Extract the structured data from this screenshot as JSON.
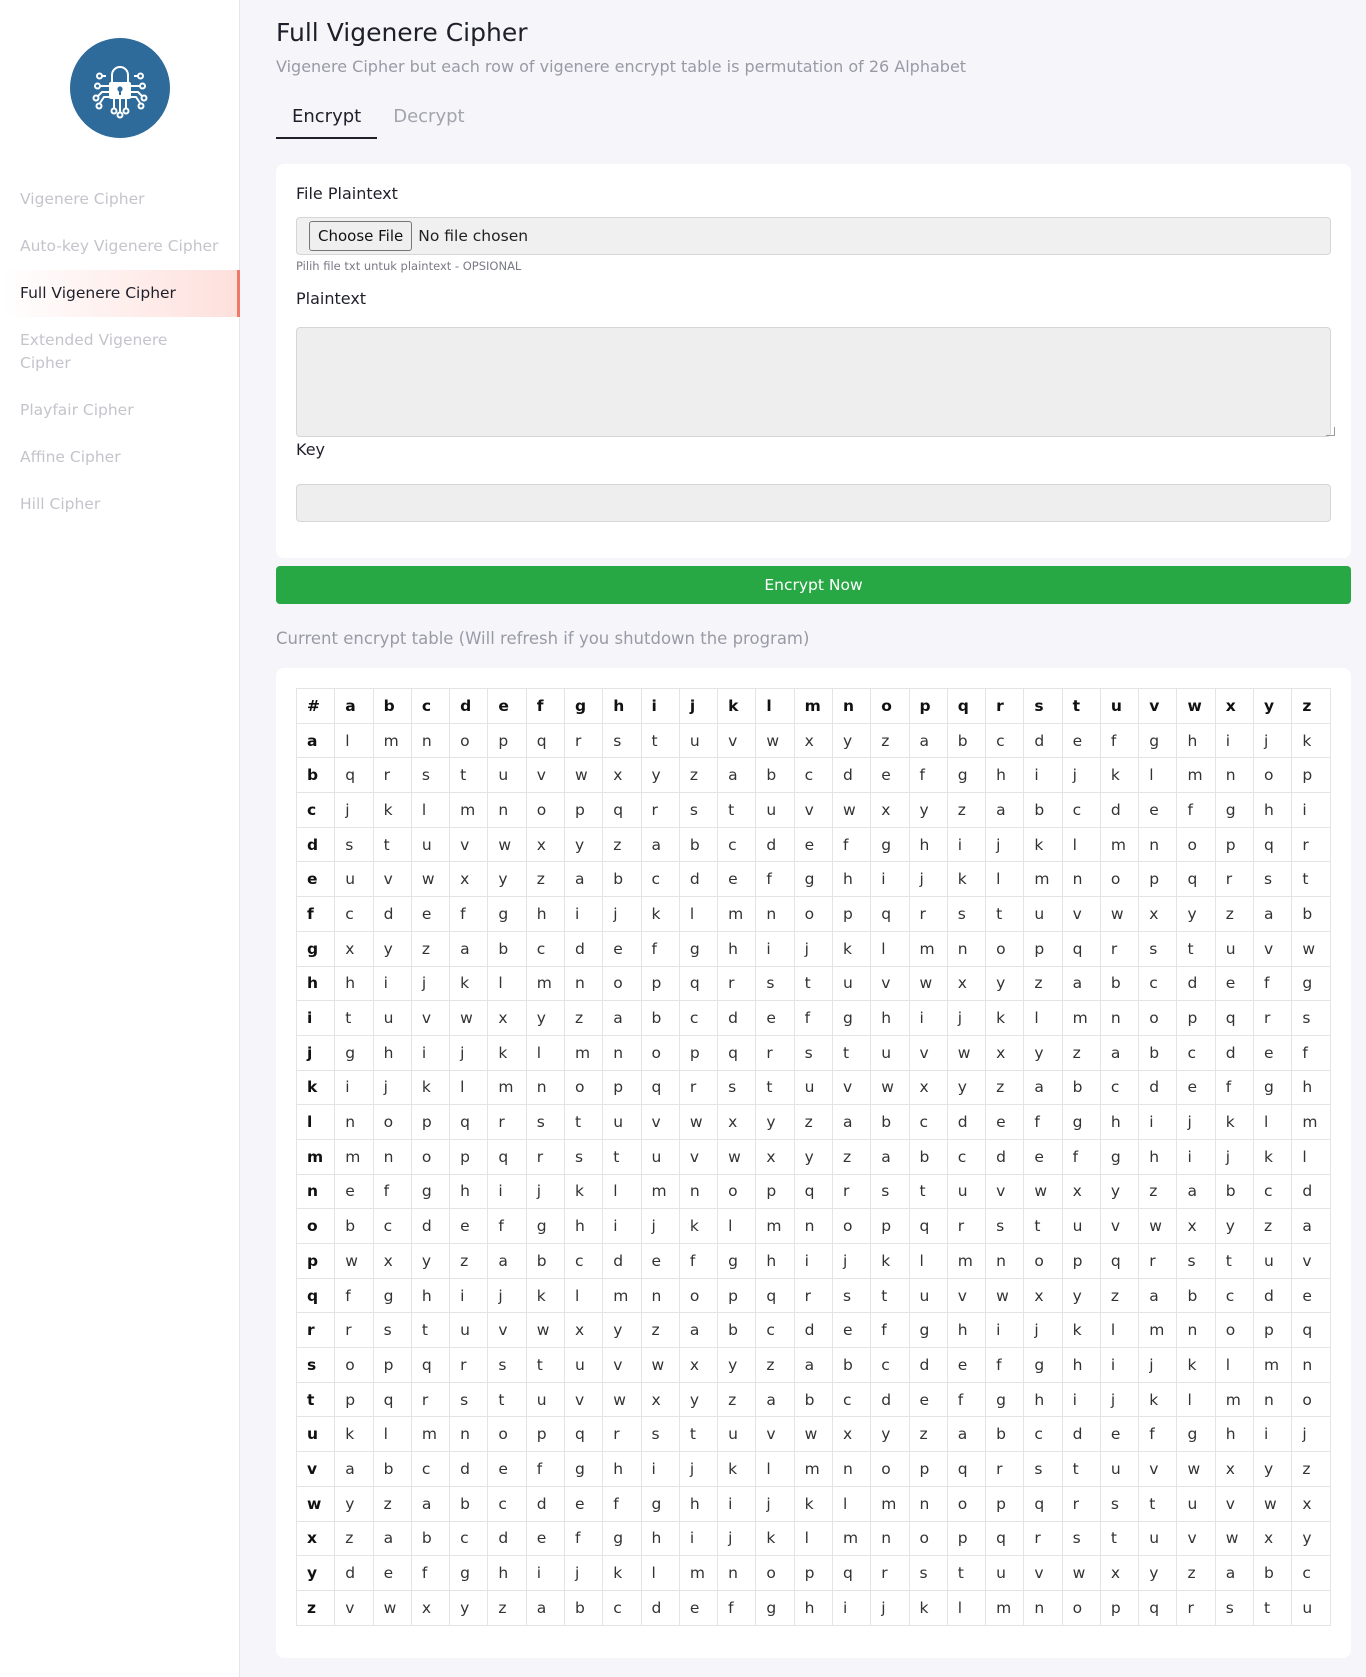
{
  "sidebar": {
    "items": [
      {
        "label": "Vigenere Cipher",
        "active": false
      },
      {
        "label": "Auto-key Vigenere Cipher",
        "active": false
      },
      {
        "label": "Full Vigenere Cipher",
        "active": true
      },
      {
        "label": "Extended Vigenere Cipher",
        "active": false
      },
      {
        "label": "Playfair Cipher",
        "active": false
      },
      {
        "label": "Affine Cipher",
        "active": false
      },
      {
        "label": "Hill Cipher",
        "active": false
      }
    ],
    "logo_icon": "lock-circuit-icon",
    "logo_color": "#2e6b9a"
  },
  "header": {
    "title": "Full Vigenere Cipher",
    "subtitle": "Vigenere Cipher but each row of vigenere encrypt table is permutation of 26 Alphabet"
  },
  "tabs": [
    {
      "label": "Encrypt",
      "active": true
    },
    {
      "label": "Decrypt",
      "active": false
    }
  ],
  "form": {
    "file_label": "File Plaintext",
    "file_button": "Choose File",
    "file_status": "No file chosen",
    "file_help": "Pilih file txt untuk plaintext - OPSIONAL",
    "plaintext_label": "Plaintext",
    "plaintext_value": "",
    "key_label": "Key",
    "key_value": "",
    "submit_label": "Encrypt Now"
  },
  "colors": {
    "accent": "#28a745",
    "active_nav_border": "#f07a6a"
  },
  "encrypt_table": {
    "caption": "Current encrypt table (Will refresh if you shutdown the program)",
    "corner": "#",
    "columns": [
      "a",
      "b",
      "c",
      "d",
      "e",
      "f",
      "g",
      "h",
      "i",
      "j",
      "k",
      "l",
      "m",
      "n",
      "o",
      "p",
      "q",
      "r",
      "s",
      "t",
      "u",
      "v",
      "w",
      "x",
      "y",
      "z"
    ],
    "rows": [
      {
        "key": "a",
        "cells": [
          "l",
          "m",
          "n",
          "o",
          "p",
          "q",
          "r",
          "s",
          "t",
          "u",
          "v",
          "w",
          "x",
          "y",
          "z",
          "a",
          "b",
          "c",
          "d",
          "e",
          "f",
          "g",
          "h",
          "i",
          "j",
          "k"
        ]
      },
      {
        "key": "b",
        "cells": [
          "q",
          "r",
          "s",
          "t",
          "u",
          "v",
          "w",
          "x",
          "y",
          "z",
          "a",
          "b",
          "c",
          "d",
          "e",
          "f",
          "g",
          "h",
          "i",
          "j",
          "k",
          "l",
          "m",
          "n",
          "o",
          "p"
        ]
      },
      {
        "key": "c",
        "cells": [
          "j",
          "k",
          "l",
          "m",
          "n",
          "o",
          "p",
          "q",
          "r",
          "s",
          "t",
          "u",
          "v",
          "w",
          "x",
          "y",
          "z",
          "a",
          "b",
          "c",
          "d",
          "e",
          "f",
          "g",
          "h",
          "i"
        ]
      },
      {
        "key": "d",
        "cells": [
          "s",
          "t",
          "u",
          "v",
          "w",
          "x",
          "y",
          "z",
          "a",
          "b",
          "c",
          "d",
          "e",
          "f",
          "g",
          "h",
          "i",
          "j",
          "k",
          "l",
          "m",
          "n",
          "o",
          "p",
          "q",
          "r"
        ]
      },
      {
        "key": "e",
        "cells": [
          "u",
          "v",
          "w",
          "x",
          "y",
          "z",
          "a",
          "b",
          "c",
          "d",
          "e",
          "f",
          "g",
          "h",
          "i",
          "j",
          "k",
          "l",
          "m",
          "n",
          "o",
          "p",
          "q",
          "r",
          "s",
          "t"
        ]
      },
      {
        "key": "f",
        "cells": [
          "c",
          "d",
          "e",
          "f",
          "g",
          "h",
          "i",
          "j",
          "k",
          "l",
          "m",
          "n",
          "o",
          "p",
          "q",
          "r",
          "s",
          "t",
          "u",
          "v",
          "w",
          "x",
          "y",
          "z",
          "a",
          "b"
        ]
      },
      {
        "key": "g",
        "cells": [
          "x",
          "y",
          "z",
          "a",
          "b",
          "c",
          "d",
          "e",
          "f",
          "g",
          "h",
          "i",
          "j",
          "k",
          "l",
          "m",
          "n",
          "o",
          "p",
          "q",
          "r",
          "s",
          "t",
          "u",
          "v",
          "w"
        ]
      },
      {
        "key": "h",
        "cells": [
          "h",
          "i",
          "j",
          "k",
          "l",
          "m",
          "n",
          "o",
          "p",
          "q",
          "r",
          "s",
          "t",
          "u",
          "v",
          "w",
          "x",
          "y",
          "z",
          "a",
          "b",
          "c",
          "d",
          "e",
          "f",
          "g"
        ]
      },
      {
        "key": "i",
        "cells": [
          "t",
          "u",
          "v",
          "w",
          "x",
          "y",
          "z",
          "a",
          "b",
          "c",
          "d",
          "e",
          "f",
          "g",
          "h",
          "i",
          "j",
          "k",
          "l",
          "m",
          "n",
          "o",
          "p",
          "q",
          "r",
          "s"
        ]
      },
      {
        "key": "j",
        "cells": [
          "g",
          "h",
          "i",
          "j",
          "k",
          "l",
          "m",
          "n",
          "o",
          "p",
          "q",
          "r",
          "s",
          "t",
          "u",
          "v",
          "w",
          "x",
          "y",
          "z",
          "a",
          "b",
          "c",
          "d",
          "e",
          "f"
        ]
      },
      {
        "key": "k",
        "cells": [
          "i",
          "j",
          "k",
          "l",
          "m",
          "n",
          "o",
          "p",
          "q",
          "r",
          "s",
          "t",
          "u",
          "v",
          "w",
          "x",
          "y",
          "z",
          "a",
          "b",
          "c",
          "d",
          "e",
          "f",
          "g",
          "h"
        ]
      },
      {
        "key": "l",
        "cells": [
          "n",
          "o",
          "p",
          "q",
          "r",
          "s",
          "t",
          "u",
          "v",
          "w",
          "x",
          "y",
          "z",
          "a",
          "b",
          "c",
          "d",
          "e",
          "f",
          "g",
          "h",
          "i",
          "j",
          "k",
          "l",
          "m"
        ]
      },
      {
        "key": "m",
        "cells": [
          "m",
          "n",
          "o",
          "p",
          "q",
          "r",
          "s",
          "t",
          "u",
          "v",
          "w",
          "x",
          "y",
          "z",
          "a",
          "b",
          "c",
          "d",
          "e",
          "f",
          "g",
          "h",
          "i",
          "j",
          "k",
          "l"
        ]
      },
      {
        "key": "n",
        "cells": [
          "e",
          "f",
          "g",
          "h",
          "i",
          "j",
          "k",
          "l",
          "m",
          "n",
          "o",
          "p",
          "q",
          "r",
          "s",
          "t",
          "u",
          "v",
          "w",
          "x",
          "y",
          "z",
          "a",
          "b",
          "c",
          "d"
        ]
      },
      {
        "key": "o",
        "cells": [
          "b",
          "c",
          "d",
          "e",
          "f",
          "g",
          "h",
          "i",
          "j",
          "k",
          "l",
          "m",
          "n",
          "o",
          "p",
          "q",
          "r",
          "s",
          "t",
          "u",
          "v",
          "w",
          "x",
          "y",
          "z",
          "a"
        ]
      },
      {
        "key": "p",
        "cells": [
          "w",
          "x",
          "y",
          "z",
          "a",
          "b",
          "c",
          "d",
          "e",
          "f",
          "g",
          "h",
          "i",
          "j",
          "k",
          "l",
          "m",
          "n",
          "o",
          "p",
          "q",
          "r",
          "s",
          "t",
          "u",
          "v"
        ]
      },
      {
        "key": "q",
        "cells": [
          "f",
          "g",
          "h",
          "i",
          "j",
          "k",
          "l",
          "m",
          "n",
          "o",
          "p",
          "q",
          "r",
          "s",
          "t",
          "u",
          "v",
          "w",
          "x",
          "y",
          "z",
          "a",
          "b",
          "c",
          "d",
          "e"
        ]
      },
      {
        "key": "r",
        "cells": [
          "r",
          "s",
          "t",
          "u",
          "v",
          "w",
          "x",
          "y",
          "z",
          "a",
          "b",
          "c",
          "d",
          "e",
          "f",
          "g",
          "h",
          "i",
          "j",
          "k",
          "l",
          "m",
          "n",
          "o",
          "p",
          "q"
        ]
      },
      {
        "key": "s",
        "cells": [
          "o",
          "p",
          "q",
          "r",
          "s",
          "t",
          "u",
          "v",
          "w",
          "x",
          "y",
          "z",
          "a",
          "b",
          "c",
          "d",
          "e",
          "f",
          "g",
          "h",
          "i",
          "j",
          "k",
          "l",
          "m",
          "n"
        ]
      },
      {
        "key": "t",
        "cells": [
          "p",
          "q",
          "r",
          "s",
          "t",
          "u",
          "v",
          "w",
          "x",
          "y",
          "z",
          "a",
          "b",
          "c",
          "d",
          "e",
          "f",
          "g",
          "h",
          "i",
          "j",
          "k",
          "l",
          "m",
          "n",
          "o"
        ]
      },
      {
        "key": "u",
        "cells": [
          "k",
          "l",
          "m",
          "n",
          "o",
          "p",
          "q",
          "r",
          "s",
          "t",
          "u",
          "v",
          "w",
          "x",
          "y",
          "z",
          "a",
          "b",
          "c",
          "d",
          "e",
          "f",
          "g",
          "h",
          "i",
          "j"
        ]
      },
      {
        "key": "v",
        "cells": [
          "a",
          "b",
          "c",
          "d",
          "e",
          "f",
          "g",
          "h",
          "i",
          "j",
          "k",
          "l",
          "m",
          "n",
          "o",
          "p",
          "q",
          "r",
          "s",
          "t",
          "u",
          "v",
          "w",
          "x",
          "y",
          "z"
        ]
      },
      {
        "key": "w",
        "cells": [
          "y",
          "z",
          "a",
          "b",
          "c",
          "d",
          "e",
          "f",
          "g",
          "h",
          "i",
          "j",
          "k",
          "l",
          "m",
          "n",
          "o",
          "p",
          "q",
          "r",
          "s",
          "t",
          "u",
          "v",
          "w",
          "x"
        ]
      },
      {
        "key": "x",
        "cells": [
          "z",
          "a",
          "b",
          "c",
          "d",
          "e",
          "f",
          "g",
          "h",
          "i",
          "j",
          "k",
          "l",
          "m",
          "n",
          "o",
          "p",
          "q",
          "r",
          "s",
          "t",
          "u",
          "v",
          "w",
          "x",
          "y"
        ]
      },
      {
        "key": "y",
        "cells": [
          "d",
          "e",
          "f",
          "g",
          "h",
          "i",
          "j",
          "k",
          "l",
          "m",
          "n",
          "o",
          "p",
          "q",
          "r",
          "s",
          "t",
          "u",
          "v",
          "w",
          "x",
          "y",
          "z",
          "a",
          "b",
          "c"
        ]
      },
      {
        "key": "z",
        "cells": [
          "v",
          "w",
          "x",
          "y",
          "z",
          "a",
          "b",
          "c",
          "d",
          "e",
          "f",
          "g",
          "h",
          "i",
          "j",
          "k",
          "l",
          "m",
          "n",
          "o",
          "p",
          "q",
          "r",
          "s",
          "t",
          "u"
        ]
      }
    ]
  }
}
